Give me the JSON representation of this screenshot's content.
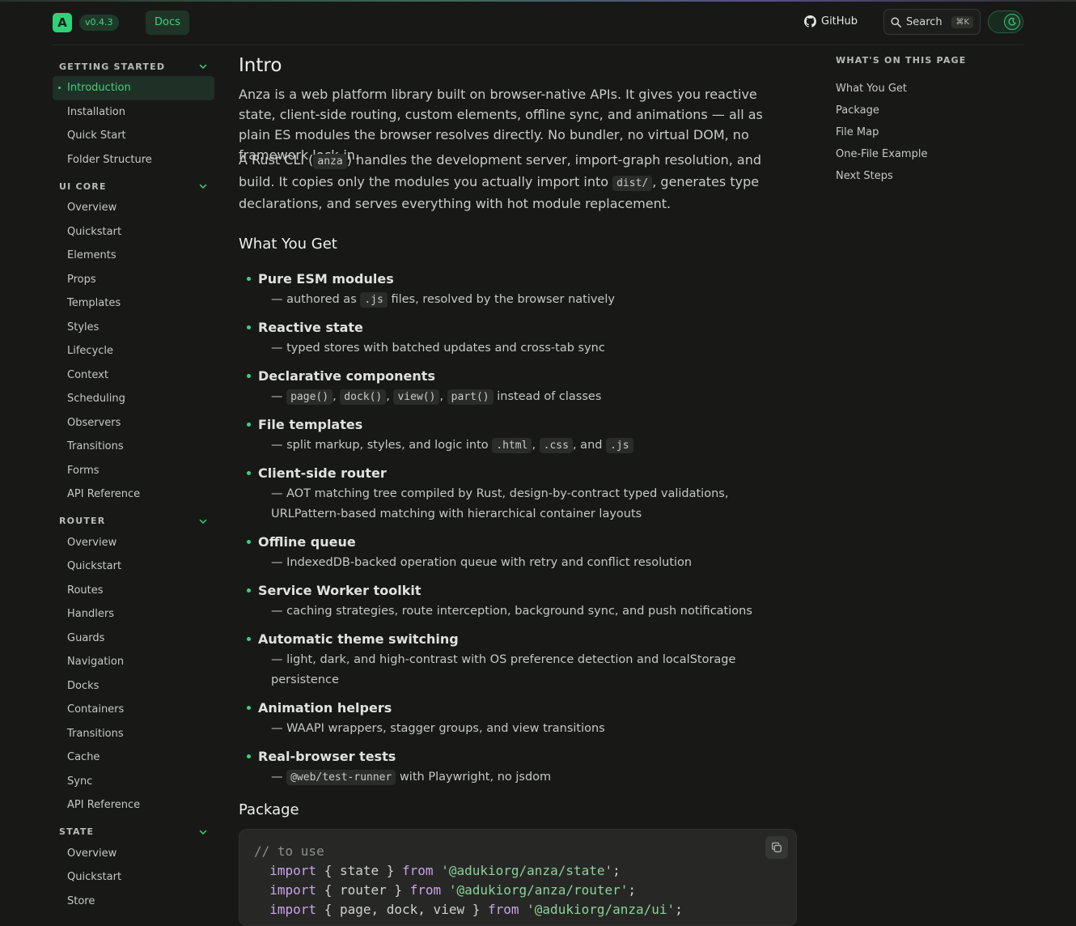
{
  "header": {
    "logo_letter": "A",
    "version": "v0.4.3",
    "docs_label": "Docs",
    "github_label": "GitHub",
    "search_label": "Search",
    "search_shortcut": "⌘K"
  },
  "sidebar": {
    "sections": [
      {
        "title": "GETTING STARTED",
        "items": [
          "Introduction",
          "Installation",
          "Quick Start",
          "Folder Structure"
        ],
        "active": "Introduction"
      },
      {
        "title": "UI CORE",
        "items": [
          "Overview",
          "Quickstart",
          "Elements",
          "Props",
          "Templates",
          "Styles",
          "Lifecycle",
          "Context",
          "Scheduling",
          "Observers",
          "Transitions",
          "Forms",
          "API Reference"
        ]
      },
      {
        "title": "ROUTER",
        "items": [
          "Overview",
          "Quickstart",
          "Routes",
          "Handlers",
          "Guards",
          "Navigation",
          "Docks",
          "Containers",
          "Transitions",
          "Cache",
          "Sync",
          "API Reference"
        ]
      },
      {
        "title": "STATE",
        "items": [
          "Overview",
          "Quickstart",
          "Store"
        ]
      }
    ]
  },
  "main": {
    "title": "Intro",
    "intro_p1": "Anza is a web platform library built on browser-native APIs. It gives you reactive state, client-side routing, custom elements, offline sync, and animations — all as plain ES modules the browser resolves directly. No bundler, no virtual DOM, no framework lock-in.",
    "intro_p2": {
      "a": "A Rust CLI (",
      "code1": "anza",
      "b": ") handles the development server, import-graph resolution, and build. It copies only the modules you actually import into ",
      "code2": "dist/",
      "c": ", generates type declarations, and serves everything with hot module replacement."
    },
    "what_you_get_heading": "What You Get",
    "features": [
      {
        "title": "Pure ESM modules",
        "desc": [
          {
            "t": "— authored as "
          },
          {
            "c": ".js"
          },
          {
            "t": " files, resolved by the browser natively"
          }
        ]
      },
      {
        "title": "Reactive state",
        "desc": [
          {
            "t": "— typed stores with batched updates and cross-tab sync"
          }
        ]
      },
      {
        "title": "Declarative components",
        "desc": [
          {
            "t": "— "
          },
          {
            "c": "page()"
          },
          {
            "t": ", "
          },
          {
            "c": "dock()"
          },
          {
            "t": ", "
          },
          {
            "c": "view()"
          },
          {
            "t": ", "
          },
          {
            "c": "part()"
          },
          {
            "t": " instead of classes"
          }
        ]
      },
      {
        "title": "File templates",
        "desc": [
          {
            "t": "— split markup, styles, and logic into "
          },
          {
            "c": ".html"
          },
          {
            "t": ", "
          },
          {
            "c": ".css"
          },
          {
            "t": ", and "
          },
          {
            "c": ".js"
          }
        ]
      },
      {
        "title": "Client-side router",
        "desc": [
          {
            "t": "— AOT matching tree compiled by Rust, design-by-contract typed validations, URLPattern-based matching with hierarchical container layouts"
          }
        ]
      },
      {
        "title": "Offline queue",
        "desc": [
          {
            "t": "— IndexedDB-backed operation queue with retry and conflict resolution"
          }
        ]
      },
      {
        "title": "Service Worker toolkit",
        "desc": [
          {
            "t": "— caching strategies, route interception, background sync, and push notifications"
          }
        ]
      },
      {
        "title": "Automatic theme switching",
        "desc": [
          {
            "t": "— light, dark, and high-contrast with OS preference detection and localStorage persistence"
          }
        ]
      },
      {
        "title": "Animation helpers",
        "desc": [
          {
            "t": "— WAAPI wrappers, stagger groups, and view transitions"
          }
        ]
      },
      {
        "title": "Real-browser tests",
        "desc": [
          {
            "t": "— "
          },
          {
            "c": "@web/test-runner"
          },
          {
            "t": " with Playwright, no jsdom"
          }
        ]
      }
    ],
    "package_heading": "Package",
    "code_lines": [
      [
        {
          "k": "comment",
          "t": "// to use"
        }
      ],
      [
        {
          "k": "plain",
          "t": "  "
        },
        {
          "k": "kw",
          "t": "import"
        },
        {
          "k": "plain",
          "t": " { state } "
        },
        {
          "k": "kw",
          "t": "from"
        },
        {
          "k": "plain",
          "t": " "
        },
        {
          "k": "str",
          "t": "'@adukiorg/anza/state'"
        },
        {
          "k": "plain",
          "t": ";"
        }
      ],
      [
        {
          "k": "plain",
          "t": "  "
        },
        {
          "k": "kw",
          "t": "import"
        },
        {
          "k": "plain",
          "t": " { router } "
        },
        {
          "k": "kw",
          "t": "from"
        },
        {
          "k": "plain",
          "t": " "
        },
        {
          "k": "str",
          "t": "'@adukiorg/anza/router'"
        },
        {
          "k": "plain",
          "t": ";"
        }
      ],
      [
        {
          "k": "plain",
          "t": "  "
        },
        {
          "k": "kw",
          "t": "import"
        },
        {
          "k": "plain",
          "t": " { page, dock, view } "
        },
        {
          "k": "kw",
          "t": "from"
        },
        {
          "k": "plain",
          "t": " "
        },
        {
          "k": "str",
          "t": "'@adukiorg/anza/ui'"
        },
        {
          "k": "plain",
          "t": ";"
        }
      ]
    ]
  },
  "toc": {
    "title": "WHAT'S ON THIS PAGE",
    "items": [
      "What You Get",
      "Package",
      "File Map",
      "One-File Example",
      "Next Steps"
    ]
  },
  "colors": {
    "accent": "#3fd07e",
    "background": "#181917",
    "code_bg": "#272826"
  },
  "icons": {
    "github": "github-icon",
    "search": "search-icon",
    "theme": "moon-icon",
    "chevron": "chevron-down-icon",
    "copy": "copy-icon"
  }
}
